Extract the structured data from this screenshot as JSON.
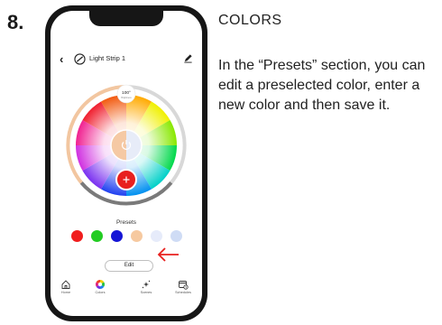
{
  "step_number": "8.",
  "heading": "COLORS",
  "description": "In the “Presets” section, you can edit a preselected color, enter a new color and then save it.",
  "app": {
    "title": "Light Strip 1",
    "brightness_value": "100°",
    "brightness_sub": "Brightness",
    "presets_label": "Presets",
    "preset_colors": [
      "#f01e1e",
      "#22cc22",
      "#1515d6",
      "#f6c9a0",
      "#e6ebfa",
      "#cfdcf5"
    ],
    "edit_label": "Edit",
    "tabs": [
      {
        "label": "Home",
        "icon": "home-icon"
      },
      {
        "label": "Colors",
        "icon": "color-wheel-icon"
      },
      {
        "label": "Scenes",
        "icon": "sparkle-icon"
      },
      {
        "label": "Schedules",
        "icon": "calendar-clock-icon"
      }
    ]
  },
  "colors": {
    "accent_red": "#e8201e",
    "phone_frame": "#161616"
  }
}
